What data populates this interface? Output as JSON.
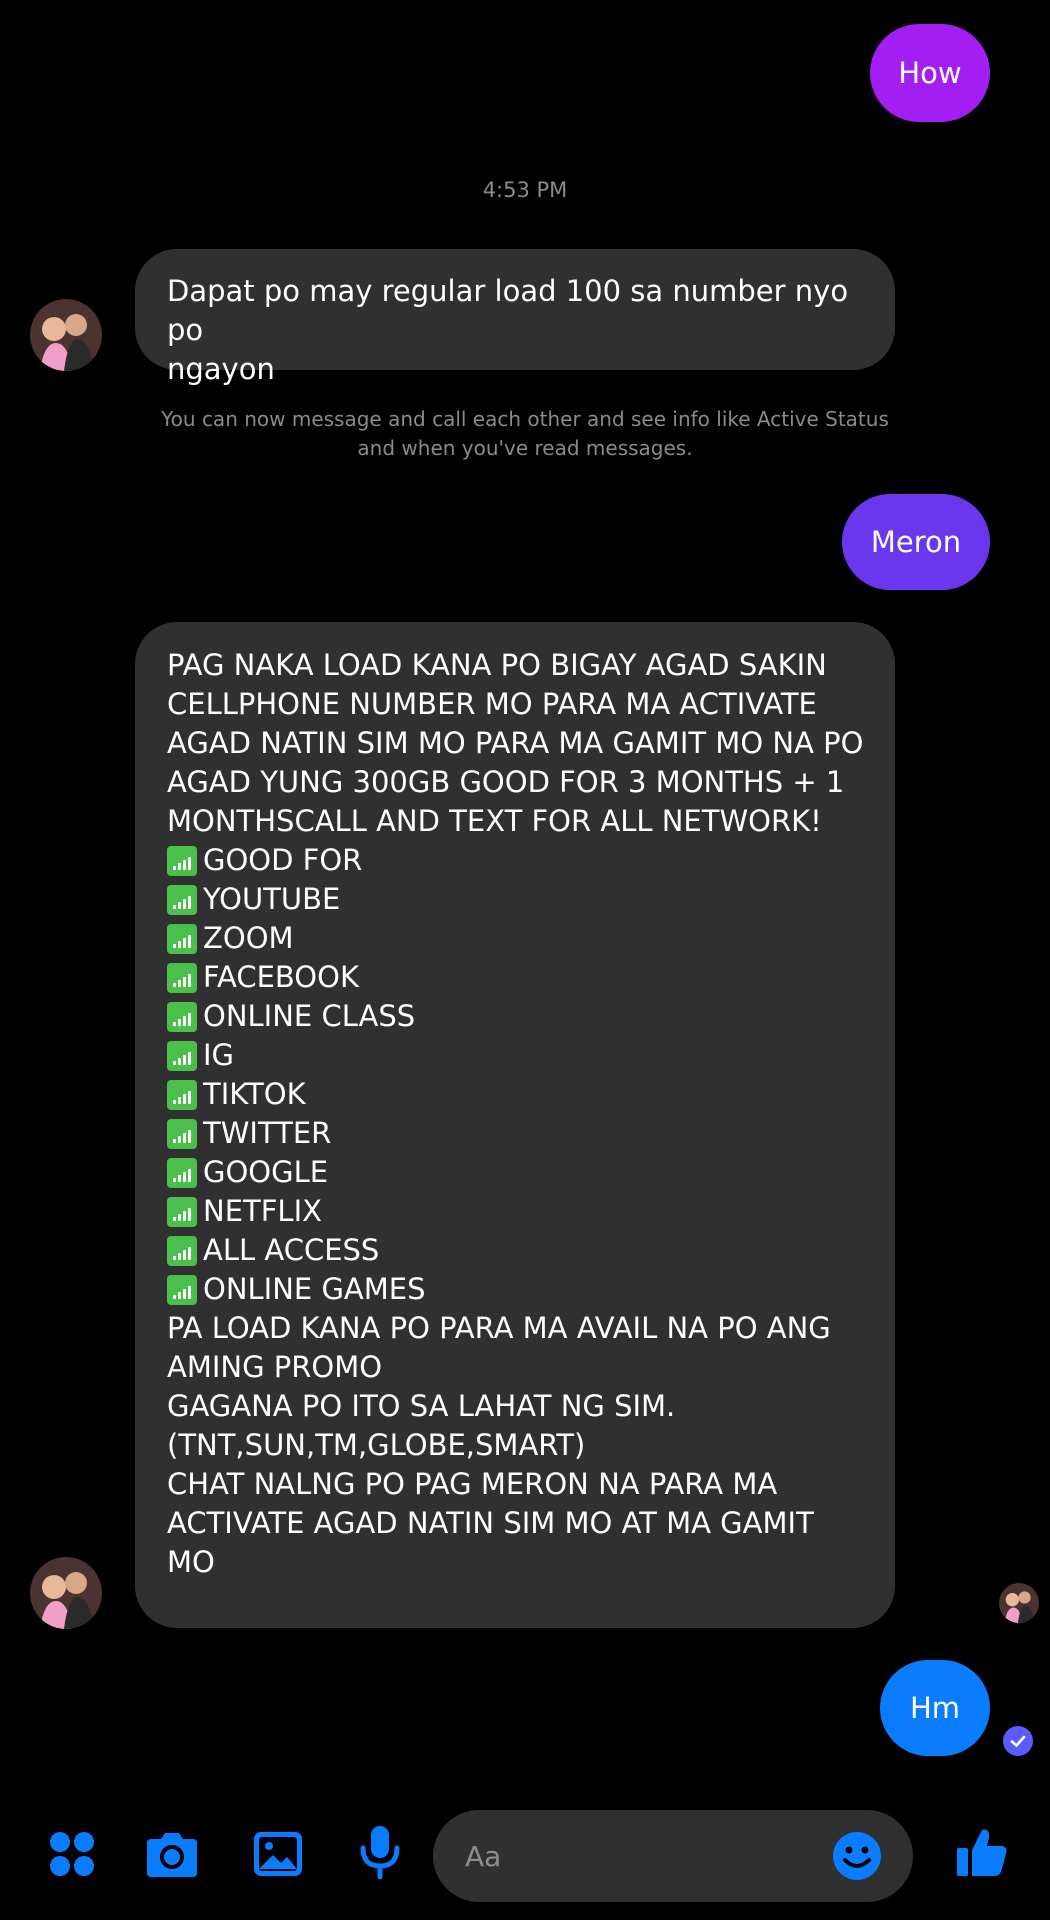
{
  "messages": {
    "out_1": "How",
    "timestamp": "4:53 PM",
    "in_1_lines": [
      "Dapat po may regular load 100 sa number nyo po",
      "ngayon"
    ],
    "system_note": "You can now message and call each other and see info like Active Status and when you've read messages.",
    "out_2": "Meron",
    "in_2_intro": [
      "PAG NAKA LOAD KANA PO BIGAY AGAD SAKIN",
      "CELLPHONE NUMBER MO PARA MA ACTIVATE",
      "AGAD NATIN SIM MO PARA MA GAMIT MO NA PO",
      "AGAD YUNG 300GB GOOD FOR 3 MONTHS + 1",
      "MONTHSCALL AND TEXT FOR ALL NETWORK!"
    ],
    "in_2_list": [
      "GOOD FOR",
      "YOUTUBE",
      "ZOOM",
      "FACEBOOK",
      "ONLINE CLASS",
      "IG",
      "TIKTOK",
      "TWITTER",
      "GOOGLE",
      "NETFLIX",
      "ALL ACCESS",
      "ONLINE GAMES"
    ],
    "in_2_outro": [
      "PA LOAD KANA PO PARA MA AVAIL NA PO ANG",
      "AMING PROMO",
      "GAGANA PO ITO SA LAHAT NG SIM.",
      "(TNT,SUN,TM,GLOBE,SMART)",
      "CHAT NALNG PO PAG MERON NA PARA MA",
      "ACTIVATE AGAD NATIN SIM MO AT MA GAMIT",
      "MO"
    ],
    "out_3": "Hm"
  },
  "composer": {
    "placeholder": "Aa"
  },
  "icons": {
    "list_bullet": "signal-bars-icon",
    "apps": "apps-grid-icon",
    "camera": "camera-icon",
    "gallery": "image-icon",
    "mic": "microphone-icon",
    "emoji": "emoji-icon",
    "like": "thumbs-up-icon",
    "read": "read-receipt-check-icon"
  },
  "colors": {
    "background": "#000000",
    "incoming_bubble": "#303030",
    "outgoing_gradient_top": "#a020f0",
    "outgoing_gradient_mid": "#6a3af0",
    "outgoing_latest": "#0a7cff",
    "accent": "#0a7cff",
    "signal_icon": "#4bbf4b",
    "muted_text": "#8a8a8a"
  }
}
